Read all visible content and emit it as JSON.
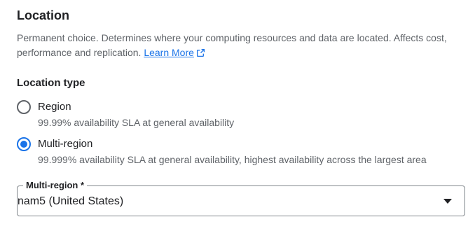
{
  "section": {
    "title": "Location",
    "description": "Permanent choice. Determines where your computing resources and data are located. Affects cost, performance and replication.",
    "learn_more_label": "Learn More",
    "learn_more_icon": "external-link-icon"
  },
  "location_type": {
    "title": "Location type",
    "options": [
      {
        "label": "Region",
        "hint": "99.99% availability SLA at general availability",
        "selected": false
      },
      {
        "label": "Multi-region",
        "hint": "99.999% availability SLA at general availability, highest availability across the largest area",
        "selected": true
      }
    ]
  },
  "multi_region_select": {
    "label": "Multi-region *",
    "value": "nam5 (United States)",
    "arrow_icon": "dropdown-arrow-icon"
  },
  "colors": {
    "accent": "#1a73e8",
    "text_primary": "#202124",
    "text_secondary": "#5f6368",
    "border": "#80868b"
  }
}
